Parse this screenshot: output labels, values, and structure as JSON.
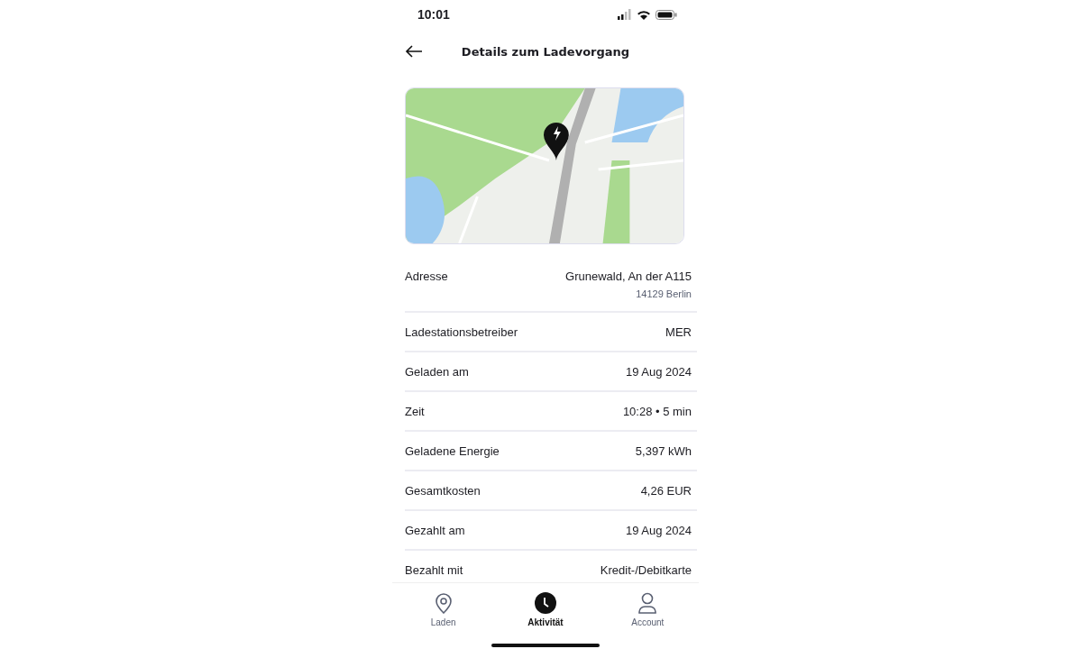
{
  "status_bar": {
    "time": "10:01"
  },
  "header": {
    "title": "Details zum Ladevorgang"
  },
  "details": [
    {
      "label": "Adresse",
      "value": "Grunewald, An der A115",
      "subvalue": "14129 Berlin"
    },
    {
      "label": "Ladestationsbetreiber",
      "value": "MER"
    },
    {
      "label": "Geladen am",
      "value": "19 Aug 2024"
    },
    {
      "label": "Zeit",
      "value": "10:28 • 5 min"
    },
    {
      "label": "Geladene Energie",
      "value": "5,397 kWh"
    },
    {
      "label": "Gesamtkosten",
      "value": "4,26 EUR"
    },
    {
      "label": "Gezahlt am",
      "value": "19 Aug 2024"
    },
    {
      "label": "Bezahlt mit",
      "value": "Kredit-/Debitkarte"
    }
  ],
  "tab_bar": [
    {
      "label": "Laden",
      "kind": "pin",
      "selected": false
    },
    {
      "label": "Aktivität",
      "kind": "clock",
      "selected": true
    },
    {
      "label": "Account",
      "kind": "person",
      "selected": false
    }
  ]
}
